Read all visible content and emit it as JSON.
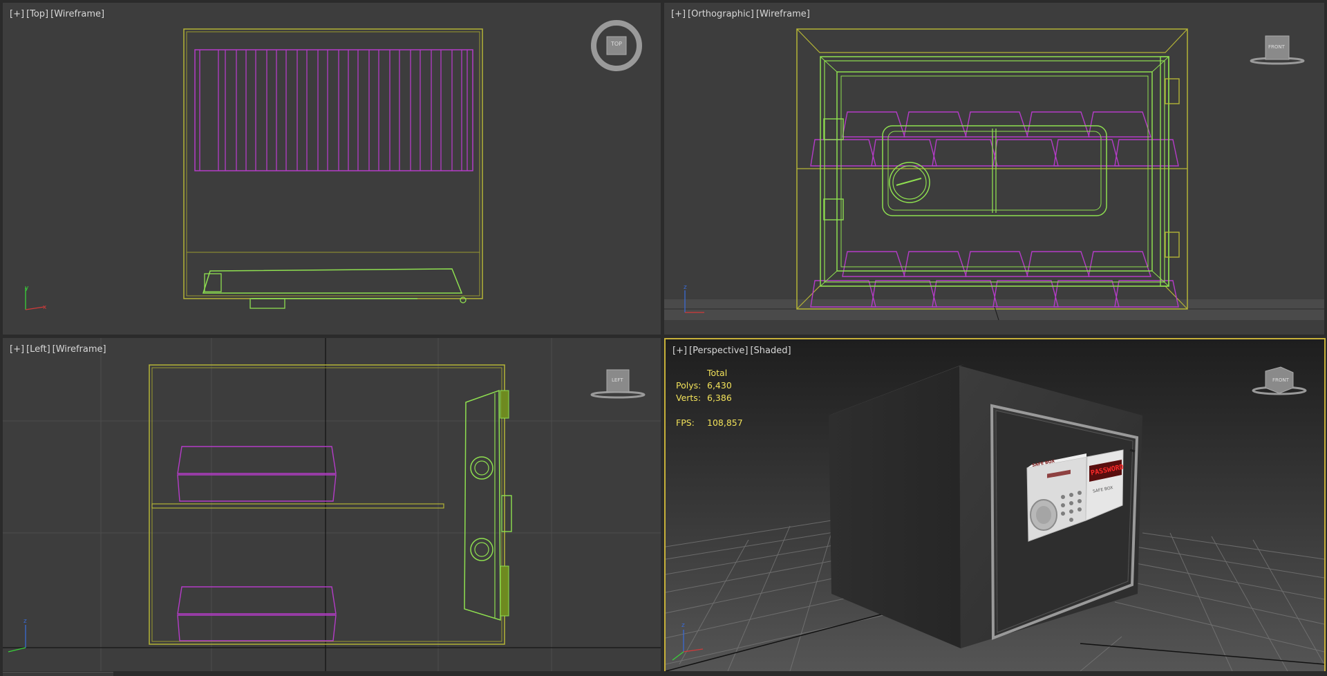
{
  "viewports": {
    "top": {
      "labels": [
        "[+]",
        "[Top]",
        "[Wireframe]"
      ],
      "viewcube": "TOP"
    },
    "front": {
      "labels": [
        "[+]",
        "[Orthographic]",
        "[Wireframe]"
      ],
      "viewcube": "FRONT"
    },
    "left": {
      "labels": [
        "[+]",
        "[Left]",
        "[Wireframe]"
      ],
      "viewcube": "LEFT"
    },
    "perspective": {
      "labels": [
        "[+]",
        "[Perspective]",
        "[Shaded]"
      ],
      "viewcube": "FRONT"
    }
  },
  "stats": {
    "header": "Total",
    "polys_label": "Polys:",
    "polys_value": "6,430",
    "verts_label": "Verts:",
    "verts_value": "6,386",
    "fps_label": "FPS:",
    "fps_value": "108,857"
  },
  "safe_panel": {
    "brand": "SAFE BOX",
    "display": "PASSWORD"
  },
  "axes": {
    "x": "x",
    "y": "y",
    "z": "z"
  },
  "colors": {
    "wire_yellow": "#b5b536",
    "wire_green": "#8fe050",
    "wire_magenta": "#b53cc8",
    "active_border": "#c8b23a",
    "stats_text": "#f2e25a"
  }
}
